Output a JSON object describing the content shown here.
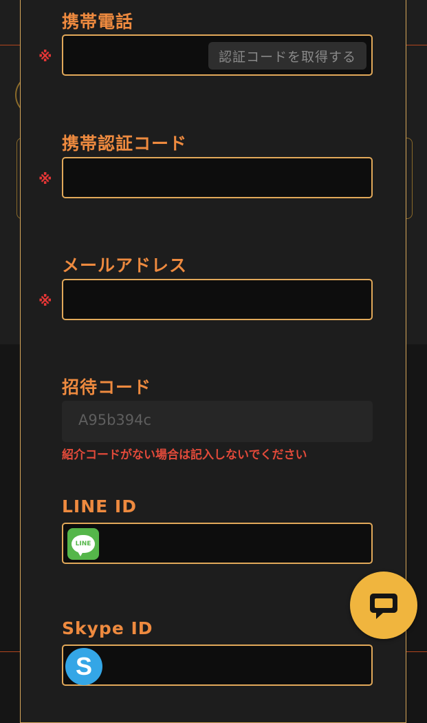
{
  "form": {
    "phone": {
      "label": "携帯電話",
      "required_mark": "※",
      "value": "",
      "code_button": "認証コードを取得する"
    },
    "phone_code": {
      "label": "携帯認証コード",
      "required_mark": "※",
      "value": ""
    },
    "email": {
      "label": "メールアドレス",
      "required_mark": "※",
      "value": ""
    },
    "invite_code": {
      "label": "招待コード",
      "value": "A95b394c",
      "hint": "紹介コードがない場合は記入しないでください"
    },
    "line_id": {
      "label": "LINE ID",
      "value": "",
      "icon": "line-icon",
      "icon_text": "LINE"
    },
    "skype_id": {
      "label": "Skype ID",
      "value": "",
      "icon": "skype-icon",
      "icon_text": "S"
    }
  },
  "chat": {
    "icon": "chat-bubble-icon"
  },
  "colors": {
    "label": "#ee8a3f",
    "field_border": "#e2a95a",
    "required": "#e43636",
    "chat_button": "#f0b53e"
  }
}
